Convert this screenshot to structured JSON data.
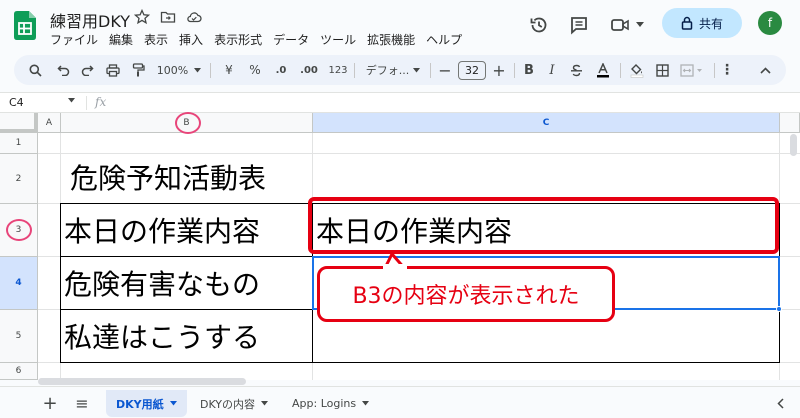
{
  "doc": {
    "title": "練習用DKY"
  },
  "menu": [
    "ファイル",
    "編集",
    "表示",
    "挿入",
    "表示形式",
    "データ",
    "ツール",
    "拡張機能",
    "ヘルプ"
  ],
  "share": {
    "label": "共有"
  },
  "avatar": {
    "initial": "f"
  },
  "toolbar": {
    "zoom": "100%",
    "currency": "¥",
    "percent": "%",
    "dec_decrease": ".0",
    "dec_increase": ".00",
    "format_123": "123",
    "font": "デフォ...",
    "font_size": "32",
    "bold": "B",
    "italic": "I"
  },
  "formula_bar": {
    "name_box": "C4",
    "fx": "fx"
  },
  "columns": [
    "A",
    "B",
    "C"
  ],
  "rows": [
    "1",
    "2",
    "3",
    "4",
    "5",
    "6"
  ],
  "cells": {
    "B2": "危険予知活動表",
    "B3": "本日の作業内容",
    "B4": "危険有害なもの",
    "B5": "私達はこうする",
    "C3": "本日の作業内容"
  },
  "callout": {
    "text": "B3の内容が表示された",
    "color": "#e60012"
  },
  "sheets": {
    "add": "+",
    "list": "≡",
    "tabs": [
      "DKY用紙",
      "DKYの内容",
      "App: Logins"
    ],
    "active": "DKY用紙"
  },
  "colors": {
    "accent": "#0b57d0",
    "share_bg": "#c2e7ff",
    "avatar": "#2a8a41",
    "selection": "#1a73e8",
    "highlight_circle": "#e8457a"
  }
}
